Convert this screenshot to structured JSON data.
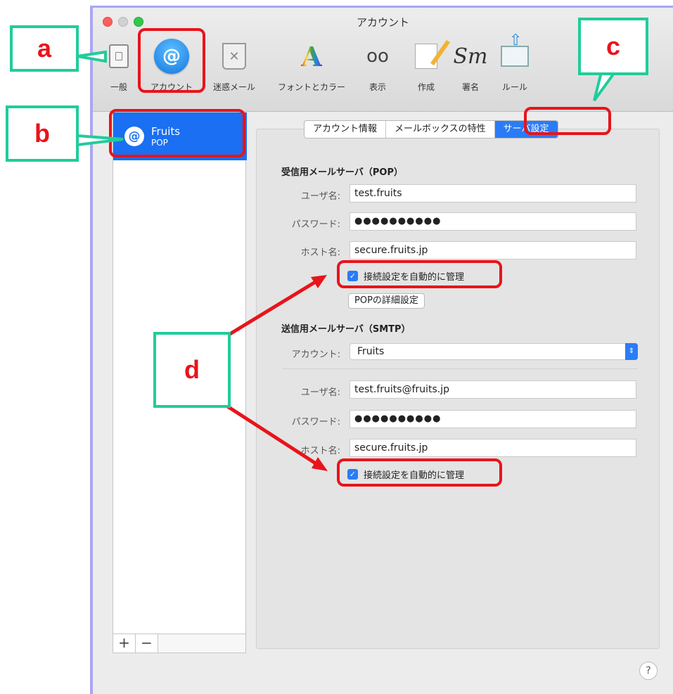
{
  "window": {
    "title": "アカウント"
  },
  "toolbar": {
    "items": [
      {
        "label": "一般",
        "icon": "general-icon"
      },
      {
        "label": "アカウント",
        "icon": "at-sign-icon"
      },
      {
        "label": "迷惑メール",
        "icon": "junk-mail-icon"
      },
      {
        "label": "フォントとカラー",
        "icon": "font-icon"
      },
      {
        "label": "表示",
        "icon": "glasses-icon"
      },
      {
        "label": "作成",
        "icon": "pencil-icon"
      },
      {
        "label": "署名",
        "icon": "signature-icon"
      },
      {
        "label": "ルール",
        "icon": "rules-icon"
      }
    ]
  },
  "sidebar": {
    "account": {
      "name": "Fruits",
      "type": "POP",
      "icon_char": "@"
    },
    "add_label": "+",
    "remove_label": "−"
  },
  "tabs": [
    {
      "label": "アカウント情報"
    },
    {
      "label": "メールボックスの特性"
    },
    {
      "label": "サーバ設定"
    }
  ],
  "incoming": {
    "heading": "受信用メールサーバ（POP）",
    "username_label": "ユーザ名:",
    "username": "test.fruits",
    "password_label": "パスワード:",
    "password": "●●●●●●●●●●",
    "host_label": "ホスト名:",
    "host": "secure.fruits.jp",
    "auto_manage": "接続設定を自動的に管理",
    "advanced_button": "POPの詳細設定"
  },
  "outgoing": {
    "heading": "送信用メールサーバ（SMTP）",
    "account_label": "アカウント:",
    "account": "Fruits",
    "username_label": "ユーザ名:",
    "username": "test.fruits@fruits.jp",
    "password_label": "パスワード:",
    "password": "●●●●●●●●●●",
    "host_label": "ホスト名:",
    "host": "secure.fruits.jp",
    "auto_manage": "接続設定を自動的に管理"
  },
  "help_label": "?",
  "callouts": {
    "a": "a",
    "b": "b",
    "c": "c",
    "d": "d"
  },
  "colors": {
    "highlight": "#e8141b",
    "callout_border": "#21cc9a",
    "accent": "#2a7cf6",
    "window_frame": "#a9a6f2"
  }
}
